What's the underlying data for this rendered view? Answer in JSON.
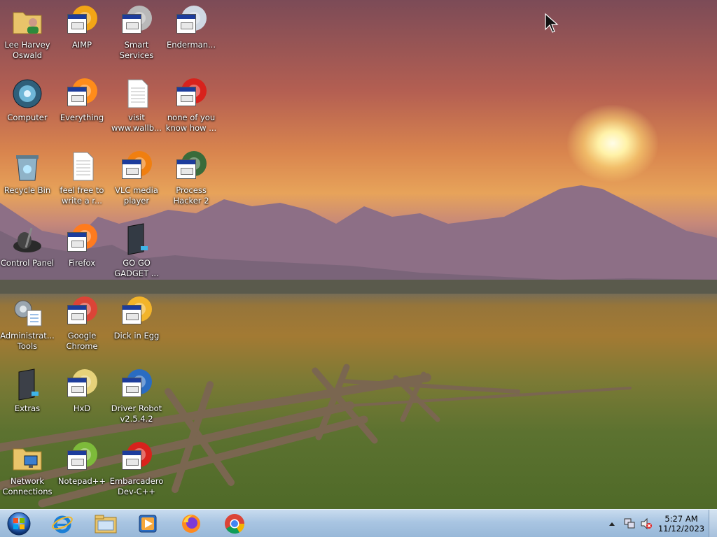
{
  "desktop": {
    "icons": [
      {
        "id": "lee-harvey-oswald",
        "label": "Lee Harvey\nOswald",
        "kind": "folder-user-icon"
      },
      {
        "id": "aimp",
        "label": "AIMP",
        "kind": "aimp-icon"
      },
      {
        "id": "smart-services",
        "label": "Smart\nServices",
        "kind": "smart-services-icon"
      },
      {
        "id": "enderman",
        "label": "Enderman...",
        "kind": "window-icon"
      },
      {
        "id": "computer",
        "label": "Computer",
        "kind": "computer-icon"
      },
      {
        "id": "everything",
        "label": "Everything",
        "kind": "everything-icon"
      },
      {
        "id": "visit-wallb",
        "label": "visit\nwww.wallb...",
        "kind": "text-file-icon"
      },
      {
        "id": "none-of-you",
        "label": "none of you\nknow how ...",
        "kind": "red-app-icon"
      },
      {
        "id": "recycle-bin",
        "label": "Recycle Bin",
        "kind": "recycle-bin-icon"
      },
      {
        "id": "feel-free",
        "label": "feel free to\nwrite a r...",
        "kind": "text-file-icon"
      },
      {
        "id": "vlc",
        "label": "VLC media\nplayer",
        "kind": "vlc-icon"
      },
      {
        "id": "process-hacker",
        "label": "Process\nHacker 2",
        "kind": "process-hacker-icon"
      },
      {
        "id": "control-panel",
        "label": "Control Panel",
        "kind": "control-panel-icon"
      },
      {
        "id": "firefox-desktop",
        "label": "Firefox",
        "kind": "firefox-icon"
      },
      {
        "id": "gogo-gadget",
        "label": "GO GO\nGADGET ...",
        "kind": "gadget-icon"
      },
      {
        "id": "admin-tools",
        "label": "Administrat...\nTools",
        "kind": "admin-tools-icon"
      },
      {
        "id": "google-chrome",
        "label": "Google\nChrome",
        "kind": "chrome-icon"
      },
      {
        "id": "dick-in-egg",
        "label": "Dick in Egg",
        "kind": "egg-app-icon"
      },
      {
        "id": "extras",
        "label": "Extras",
        "kind": "extras-icon"
      },
      {
        "id": "hxd",
        "label": "HxD",
        "kind": "hxd-icon"
      },
      {
        "id": "driver-robot",
        "label": "Driver Robot\nv2.5.4.2",
        "kind": "driver-robot-icon"
      },
      {
        "id": "network-connections",
        "label": "Network\nConnections",
        "kind": "network-icon"
      },
      {
        "id": "notepadpp",
        "label": "Notepad++",
        "kind": "notepadpp-icon"
      },
      {
        "id": "embarcadero",
        "label": "Embarcadero\nDev-C++",
        "kind": "devcpp-icon"
      }
    ]
  },
  "taskbar": {
    "start": "start-orb-icon",
    "pinned": [
      "internet-explorer-icon",
      "file-explorer-icon",
      "media-player-icon",
      "firefox-icon",
      "chrome-icon"
    ],
    "tray": {
      "icons": [
        "show-hidden-icons-arrow",
        "network-tray-icon",
        "volume-muted-icon"
      ],
      "time": "5:27 AM",
      "date": "11/12/2023"
    }
  }
}
